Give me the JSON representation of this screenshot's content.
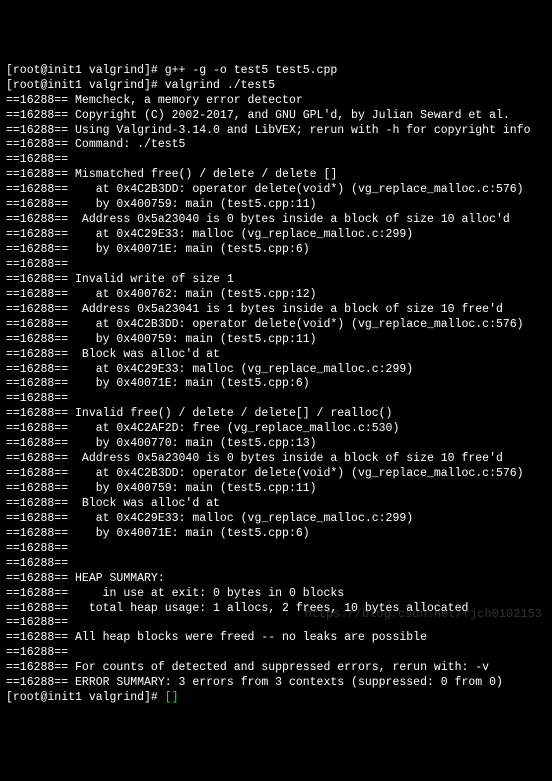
{
  "terminal": {
    "lines": [
      "[root@init1 valgrind]# g++ -g -o test5 test5.cpp",
      "[root@init1 valgrind]# valgrind ./test5",
      "==16288== Memcheck, a memory error detector",
      "==16288== Copyright (C) 2002-2017, and GNU GPL'd, by Julian Seward et al.",
      "==16288== Using Valgrind-3.14.0 and LibVEX; rerun with -h for copyright info",
      "==16288== Command: ./test5",
      "==16288==",
      "==16288== Mismatched free() / delete / delete []",
      "==16288==    at 0x4C2B3DD: operator delete(void*) (vg_replace_malloc.c:576)",
      "==16288==    by 0x400759: main (test5.cpp:11)",
      "==16288==  Address 0x5a23040 is 0 bytes inside a block of size 10 alloc'd",
      "==16288==    at 0x4C29E33: malloc (vg_replace_malloc.c:299)",
      "==16288==    by 0x40071E: main (test5.cpp:6)",
      "==16288==",
      "==16288== Invalid write of size 1",
      "==16288==    at 0x400762: main (test5.cpp:12)",
      "==16288==  Address 0x5a23041 is 1 bytes inside a block of size 10 free'd",
      "==16288==    at 0x4C2B3DD: operator delete(void*) (vg_replace_malloc.c:576)",
      "==16288==    by 0x400759: main (test5.cpp:11)",
      "==16288==  Block was alloc'd at",
      "==16288==    at 0x4C29E33: malloc (vg_replace_malloc.c:299)",
      "==16288==    by 0x40071E: main (test5.cpp:6)",
      "==16288==",
      "==16288== Invalid free() / delete / delete[] / realloc()",
      "==16288==    at 0x4C2AF2D: free (vg_replace_malloc.c:530)",
      "==16288==    by 0x400770: main (test5.cpp:13)",
      "==16288==  Address 0x5a23040 is 0 bytes inside a block of size 10 free'd",
      "==16288==    at 0x4C2B3DD: operator delete(void*) (vg_replace_malloc.c:576)",
      "==16288==    by 0x400759: main (test5.cpp:11)",
      "==16288==  Block was alloc'd at",
      "==16288==    at 0x4C29E33: malloc (vg_replace_malloc.c:299)",
      "==16288==    by 0x40071E: main (test5.cpp:6)",
      "==16288==",
      "==16288==",
      "==16288== HEAP SUMMARY:",
      "==16288==     in use at exit: 0 bytes in 0 blocks",
      "==16288==   total heap usage: 1 allocs, 2 frees, 10 bytes allocated",
      "==16288==",
      "==16288== All heap blocks were freed -- no leaks are possible",
      "==16288==",
      "==16288== For counts of detected and suppressed errors, rerun with: -v",
      "==16288== ERROR SUMMARY: 3 errors from 3 contexts (suppressed: 0 from 0)"
    ],
    "final_prompt": "[root@init1 valgrind]# ",
    "watermark": "https://blog.csdn.net/fjch0102153"
  }
}
